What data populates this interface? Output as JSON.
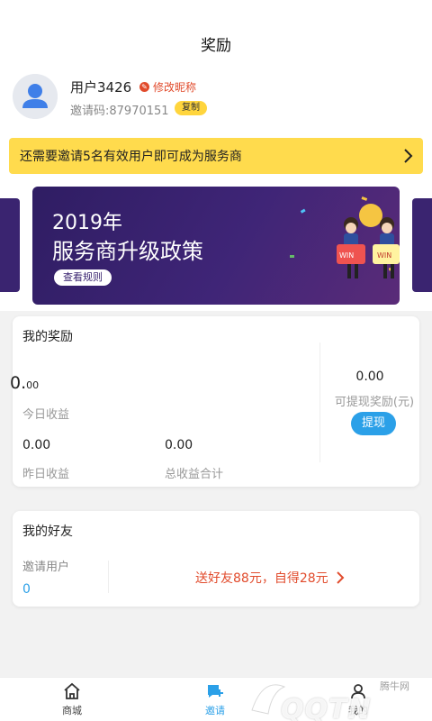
{
  "header": {
    "title": "奖励"
  },
  "profile": {
    "username": "用户3426",
    "edit_label": "修改昵称",
    "invite_code": "邀请码:87970151",
    "copy_label": "复制"
  },
  "notice": {
    "text": "还需要邀请5名有效用户即可成为服务商"
  },
  "banner": {
    "year": "2019年",
    "title": "服务商升级政策",
    "button_label": "查看规则"
  },
  "rewards": {
    "title": "我的奖励",
    "today_value_int": "0.",
    "today_value_dec": "00",
    "today_label": "今日收益",
    "yesterday_value": "0.00",
    "yesterday_label": "昨日收益",
    "total_value": "0.00",
    "total_label": "总收益合计",
    "withdrawable_value": "0.00",
    "withdrawable_label": "可提现奖励(元)",
    "withdraw_button": "提现"
  },
  "friends": {
    "title": "我的好友",
    "invited_label": "邀请用户",
    "invited_count": "0",
    "promo_text": "送好友88元，自得28元"
  },
  "tabbar": {
    "items": [
      {
        "label": "商城",
        "icon": "home-icon"
      },
      {
        "label": "邀请",
        "icon": "invite-icon",
        "active": true
      },
      {
        "label": "我的",
        "icon": "user-icon"
      }
    ]
  },
  "watermark": {
    "text": "QQTN",
    "cn": "腾牛网"
  },
  "colors": {
    "accent_blue": "#2ba0e8",
    "accent_red": "#e14b2c",
    "notice_yellow": "#ffdb4d",
    "banner_purple": "#3a2470"
  }
}
